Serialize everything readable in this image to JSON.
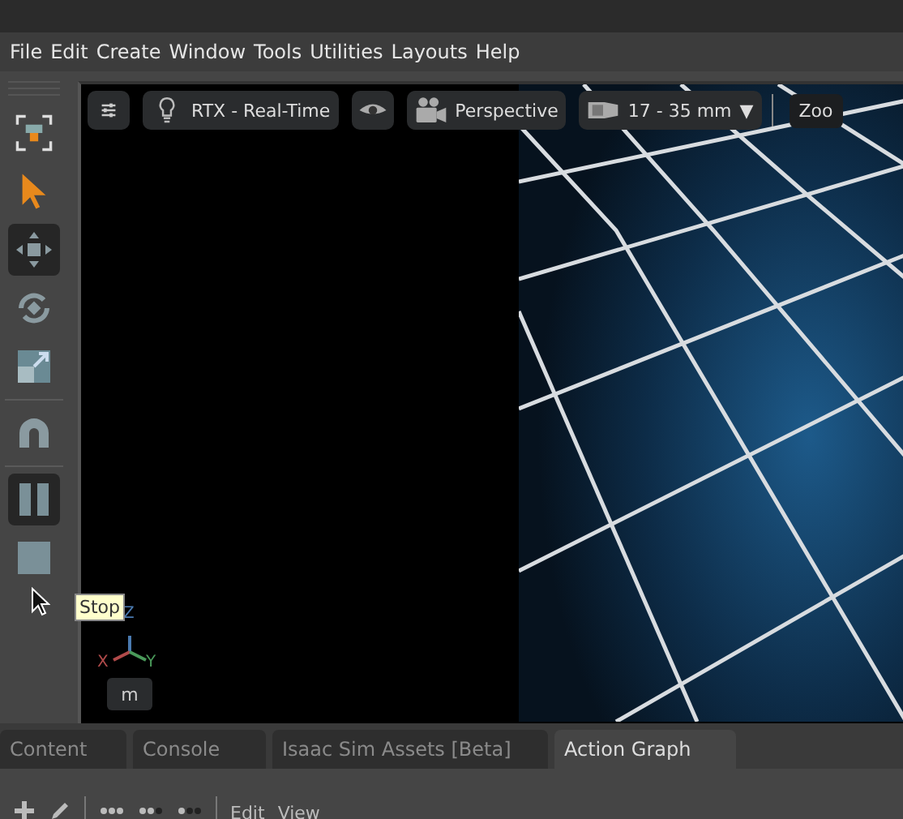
{
  "menu": [
    "File",
    "Edit",
    "Create",
    "Window",
    "Tools",
    "Utilities",
    "Layouts",
    "Help"
  ],
  "viewport_toolbar": [
    {
      "kind": "settings"
    },
    {
      "kind": "render",
      "label": "RTX - Real-Time"
    },
    {
      "kind": "eye"
    },
    {
      "kind": "camera",
      "label": "Perspective"
    },
    {
      "kind": "lens",
      "label": "17 - 35 mm",
      "caret": "▼"
    },
    {
      "kind": "text",
      "label": "Zoo"
    }
  ],
  "tools": [
    {
      "kind": "selectmode",
      "selected": false
    },
    {
      "kind": "arrow",
      "selected": false
    },
    {
      "kind": "move",
      "selected": true
    },
    {
      "kind": "rotate",
      "selected": false
    },
    {
      "kind": "scale",
      "selected": false
    },
    {
      "kind": "snap",
      "selected": false
    },
    {
      "kind": "pause",
      "selected": true
    },
    {
      "kind": "stop",
      "selected": false
    }
  ],
  "tooltip": "Stop",
  "axes": {
    "x": "X",
    "y": "Y",
    "z": "Z"
  },
  "units_button": "m",
  "tabs": [
    {
      "label": "Content",
      "selected": false
    },
    {
      "label": "Console",
      "selected": false
    },
    {
      "label": "Isaac Sim Assets [Beta]",
      "selected": false
    },
    {
      "label": "Action Graph",
      "selected": true
    }
  ],
  "graph_toolbar": [
    "Edit",
    "View"
  ]
}
